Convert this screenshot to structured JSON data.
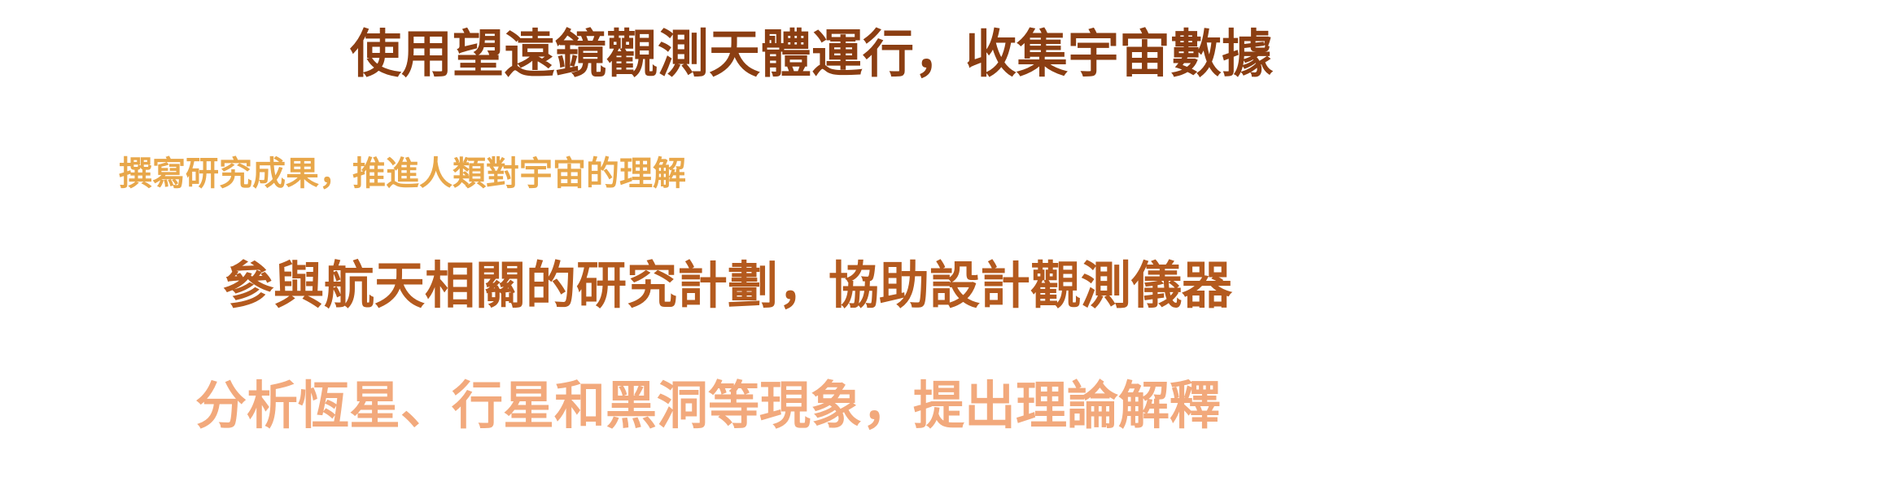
{
  "lines": [
    {
      "text": "使用望遠鏡觀測天體運行，收集宇宙數據",
      "color": "#8b3e12"
    },
    {
      "text": "撰寫研究成果，推進人類對宇宙的理解",
      "color": "#e8a74a"
    },
    {
      "text": "參與航天相關的研究計劃，協助設計觀測儀器",
      "color": "#b45a1e"
    },
    {
      "text": "分析恆星、行星和黑洞等現象，提出理論解釋",
      "color": "#f2a97c"
    }
  ]
}
